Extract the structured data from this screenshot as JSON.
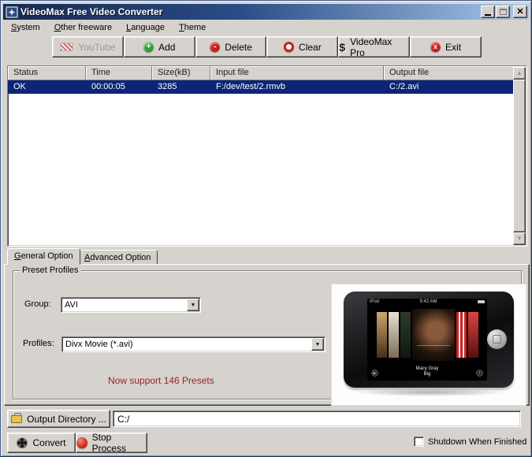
{
  "window": {
    "title": "VideoMax Free Video Converter"
  },
  "menu": {
    "items": [
      {
        "label": "System"
      },
      {
        "label": "Other freeware"
      },
      {
        "label": "Language"
      },
      {
        "label": "Theme"
      }
    ]
  },
  "toolbar": {
    "buttons": [
      {
        "label": "YouTube",
        "icon": "youtube-icon",
        "disabled": true
      },
      {
        "label": "Add",
        "icon": "plus-circle-icon",
        "disabled": false
      },
      {
        "label": "Delete",
        "icon": "minus-circle-icon",
        "disabled": false
      },
      {
        "label": "Clear",
        "icon": "clear-circle-icon",
        "disabled": false
      },
      {
        "label": "VideoMax Pro",
        "icon": "dollar-icon",
        "disabled": false
      },
      {
        "label": "Exit",
        "icon": "exit-circle-icon",
        "disabled": false
      }
    ],
    "dollar_glyph": "$",
    "exit_glyph": "x",
    "add_glyph": "+",
    "delete_glyph": "-"
  },
  "file_list": {
    "columns": [
      "Status",
      "Time",
      "Size(kB)",
      "Input file",
      "Output file"
    ],
    "rows": [
      {
        "status": "OK",
        "time": "00:00:05",
        "size": "3285",
        "input": "F:/dev/test/2.rmvb",
        "output": "C:/2.avi"
      }
    ],
    "selection_color": "#0d2577"
  },
  "tabs": [
    {
      "label": "General Option",
      "active": true
    },
    {
      "label": "Advanced Option",
      "active": false
    }
  ],
  "preset": {
    "group_box_label": "Preset Profiles",
    "group_label": "Group:",
    "group_value": "AVI",
    "profiles_label": "Profiles:",
    "profiles_value": "Divx Movie (*.avi)",
    "note": "Now support 146 Presets",
    "note_color": "#9e1f1f"
  },
  "device_preview": {
    "status_left": "iPod",
    "status_time": "9:42 AM",
    "caption_artist": "Macy Gray",
    "caption_title": "Big",
    "play_glyph": "▶",
    "info_glyph": "i"
  },
  "output": {
    "button_label": "Output Directory ...",
    "path_value": "C:/"
  },
  "actions": {
    "convert_label": "Convert",
    "stop_label": "Stop Process",
    "shutdown_label": "Shutdown When Finished"
  },
  "colors": {
    "titlebar_gradient_start": "#16294e",
    "titlebar_gradient_end": "#a7c8ea",
    "window_bg": "#d6d3ce"
  }
}
